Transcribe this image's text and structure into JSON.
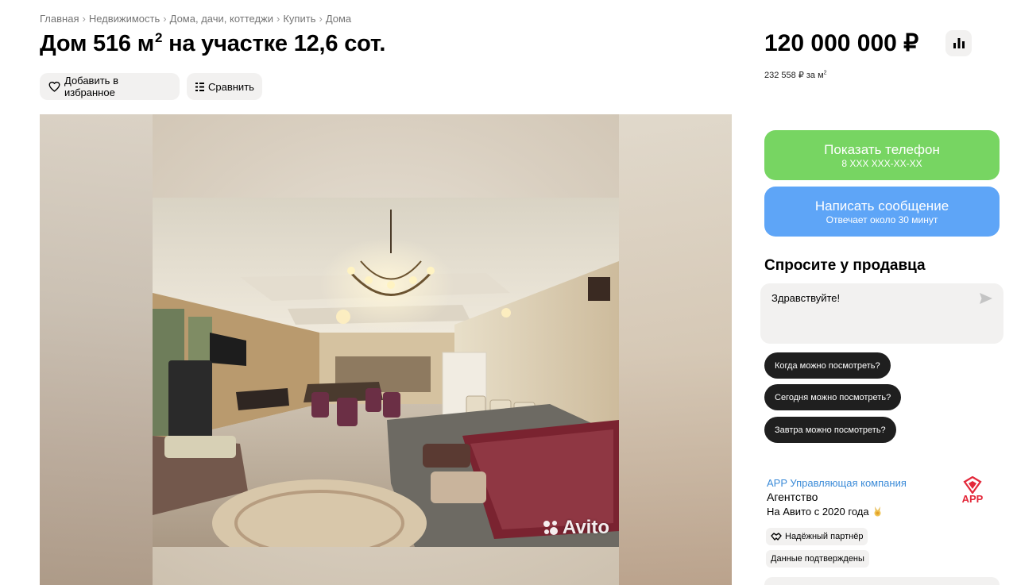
{
  "breadcrumb": [
    "Главная",
    "Недвижимость",
    "Дома, дачи, коттеджи",
    "Купить",
    "Дома"
  ],
  "breadcrumb_separator": "›",
  "listing": {
    "title_prefix": "Дом 516 м",
    "title_sup": "2",
    "title_suffix": " на участке 12,6 сот."
  },
  "actions": {
    "favorite_label": "Добавить в избранное",
    "compare_label": "Сравнить"
  },
  "price": {
    "amount": "120 000 000 ₽",
    "per_m2_prefix": "232 558 ₽ за м",
    "per_m2_sup": "2"
  },
  "contact": {
    "show_phone_label": "Показать телефон",
    "phone_masked": "8 XXX XXX-XX-XX",
    "message_label": "Написать сообщение",
    "response_time": "Отвечает около 30 минут"
  },
  "ask_seller": {
    "title": "Спросите у продавца",
    "message": "Здравствуйте!",
    "quick_questions": [
      "Когда можно посмотреть?",
      "Сегодня можно посмотреть?",
      "Завтра можно посмотреть?"
    ]
  },
  "seller": {
    "name": "APP Управляющая компания",
    "type": "Агентство",
    "since": "На Авито с 2020 года",
    "logo_text": "APP",
    "badges": [
      "Надёжный партнёр",
      "Данные подтверждены"
    ]
  },
  "gallery": {
    "watermark": "Avito"
  },
  "colors": {
    "phone_button": "#77d562",
    "message_button": "#5ea5f7",
    "seller_link": "#3b8bd8",
    "logo_red": "#e3283a",
    "chip_dark": "#1f1f1f"
  }
}
